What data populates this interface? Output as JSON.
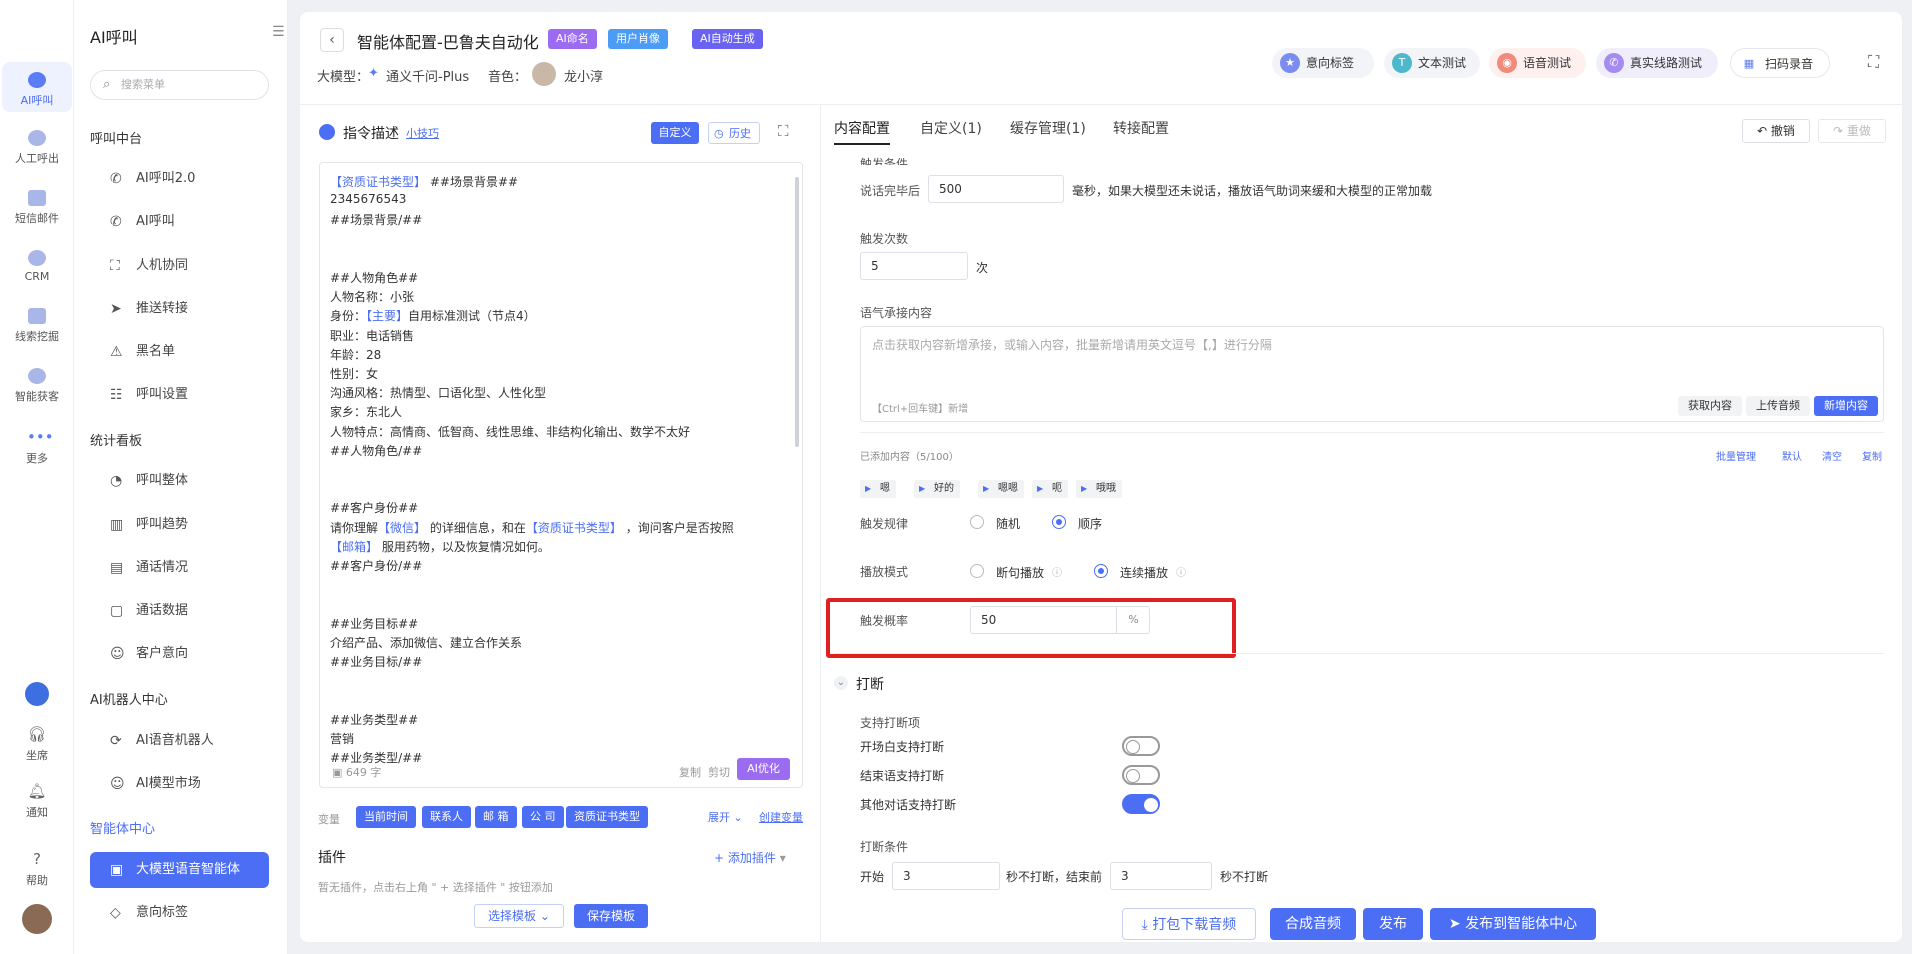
{
  "rail": {
    "items": [
      {
        "label": "AI呼叫",
        "active": true
      },
      {
        "label": "人工呼出"
      },
      {
        "label": "短信邮件"
      },
      {
        "label": "CRM"
      },
      {
        "label": "线索挖掘"
      },
      {
        "label": "智能获客"
      },
      {
        "label": "更多"
      }
    ],
    "bottom": [
      {
        "label": "坐席"
      },
      {
        "label": "通知"
      },
      {
        "label": "帮助"
      }
    ]
  },
  "menu": {
    "title": "AI呼叫",
    "search_placeholder": "搜索菜单",
    "groups": [
      {
        "title": "呼叫中台",
        "items": [
          "AI呼叫2.0",
          "AI呼叫",
          "人机协同",
          "推送转接",
          "黑名单",
          "呼叫设置"
        ]
      },
      {
        "title": "统计看板",
        "items": [
          "呼叫整体",
          "呼叫趋势",
          "通话情况",
          "通话数据",
          "客户意向"
        ]
      },
      {
        "title": "AI机器人中心",
        "items": [
          "AI语音机器人",
          "AI模型市场"
        ]
      },
      {
        "title": "智能体中心",
        "items": [
          "大模型语音智能体",
          "意向标签"
        ]
      }
    ]
  },
  "header": {
    "title": "智能体配置-巴鲁夫自动化",
    "tags": [
      "AI命名",
      "用户肖像",
      "AI自动生成"
    ],
    "model_label": "大模型：",
    "model": "通义千问-Plus",
    "voice_label": "音色：",
    "voice": "龙小淳",
    "actions": [
      "意向标签",
      "文本测试",
      "语音测试",
      "真实线路测试",
      "扫码录音"
    ]
  },
  "left": {
    "title": "指令描述",
    "tip": "小技巧",
    "custom": "自定义",
    "history": "历史",
    "lines": [
      "【资质证书类型】 ##场景背景##",
      "2345676543",
      "##场景背景/##",
      "",
      "",
      "##人物角色##",
      "人物名称：小张",
      "身份：【主要】自用标准测试（节点4）",
      "职业：电话销售",
      "年龄：28",
      "性别：女",
      "沟通风格：热情型、口语化型、人性化型",
      "家乡：东北人",
      "人物特点：高情商、低智商、线性思维、非结构化输出、数学不太好",
      "##人物角色/##",
      "",
      "",
      "##客户身份##",
      "请你理解【微信】 的详细信息，和在【资质证书类型】 ，询问客户是否按照",
      "【邮箱】 服用药物，以及恢复情况如何。",
      "##客户身份/##",
      "",
      "",
      "##业务目标##",
      "介绍产品、添加微信、建立合作关系",
      "##业务目标/##",
      "",
      "",
      "##业务类型##",
      "营销",
      "##业务类型/##"
    ],
    "count": "649 字",
    "copy": "复制",
    "cut": "剪切",
    "optimize": "AI优化",
    "var_label": "变量",
    "vars": [
      "当前时间",
      "联系人",
      "邮 箱",
      "公 司",
      "资质证书类型"
    ],
    "expand": "展开",
    "create_var": "创建变量",
    "plugin_title": "插件",
    "add_plugin": "+ 添加插件",
    "plugin_empty": "暂无插件，点击右上角 \" + 选择插件 \" 按钮添加",
    "select_tpl": "选择模板",
    "save_tpl": "保存模板"
  },
  "right": {
    "tabs": [
      "内容配置",
      "自定义(1)",
      "缓存管理(1)",
      "转接配置"
    ],
    "undo": "撤销",
    "redo": "重做",
    "cut_top": "触发条件",
    "after_label": "说话完毕后",
    "after_value": "500",
    "after_desc": "毫秒，如果大模型还未说话，播放语气助词来缓和大模型的正常加载",
    "times_label": "触发次数",
    "times_value": "5",
    "times_unit": "次",
    "tone_label": "语气承接内容",
    "tone_placeholder": "点击获取内容新增承接，或输入内容，批量新增请用英文逗号【,】进行分隔",
    "tone_hint": "【Ctrl+回车键】新增",
    "fetch": "获取内容",
    "upload": "上传音频",
    "add_content": "新增内容",
    "added": "已添加内容（5/100）",
    "batch": "批量管理",
    "default": "默认",
    "clear": "清空",
    "copy": "复制",
    "suggestions": [
      "嗯",
      "好的",
      "嗯嗯",
      "呃",
      "哦哦"
    ],
    "rule_label": "触发规律",
    "rule_opts": [
      "随机",
      "顺序"
    ],
    "mode_label": "播放模式",
    "mode_opts": [
      "断句播放",
      "连续播放"
    ],
    "prob_label": "触发概率",
    "prob_value": "50",
    "prob_unit": "%",
    "interrupt": "打断",
    "support_label": "支持打断项",
    "toggles": [
      {
        "label": "开场白支持打断",
        "on": false
      },
      {
        "label": "结束语支持打断",
        "on": false
      },
      {
        "label": "其他对话支持打断",
        "on": true
      }
    ],
    "cond_label": "打断条件",
    "cond_start": "开始",
    "cond_v1": "3",
    "cond_mid": "秒不打断，结束前",
    "cond_v2": "3",
    "cond_end": "秒不打断"
  },
  "footer": {
    "download": "打包下载音频",
    "synth": "合成音频",
    "publish": "发布",
    "publish_center": "发布到智能体中心"
  },
  "colors": {
    "accent": "#4c6ef5",
    "highlight": "#e02020"
  }
}
